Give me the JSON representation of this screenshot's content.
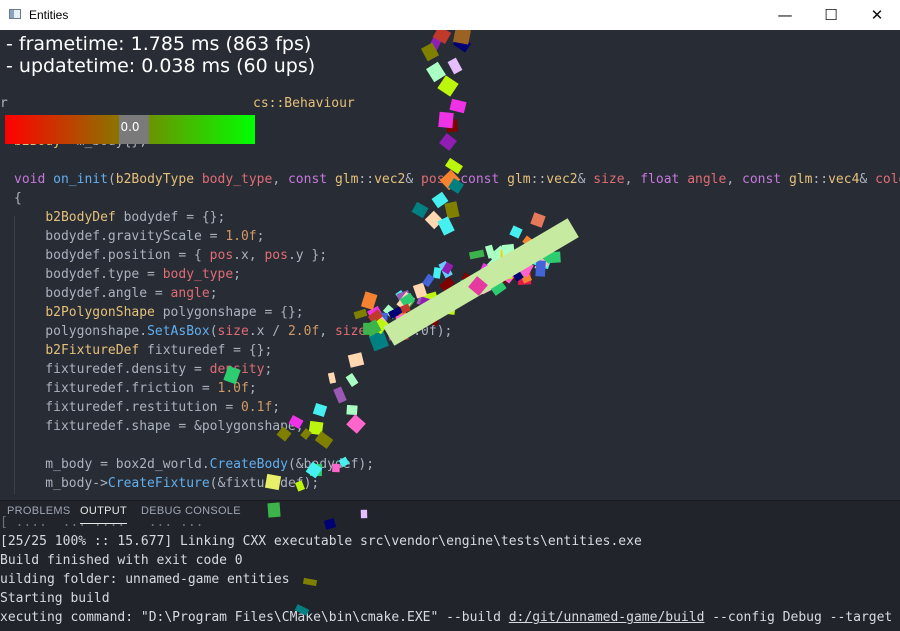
{
  "window": {
    "title": "Entities",
    "minimize_glyph": "—",
    "maximize_glyph": "☐",
    "close_glyph": "✕"
  },
  "overlay": {
    "frametime": "- frametime: 1.785 ms (863 fps)",
    "updatetime": "- updatetime: 0.038 ms (60 ups)",
    "slider_value": "0.0",
    "slider_level": 0.5
  },
  "code": [
    [
      "",
      "",
      "",
      "",
      "",
      "",
      "",
      "",
      "",
      "",
      "",
      "",
      "",
      "",
      "",
      "",
      "",
      "",
      "",
      "",
      "",
      "",
      ""
    ],
    [
      "tx",
      "r"
    ],
    [],
    [
      "ty",
      "b2Body",
      "tx",
      "* m_body{};"
    ],
    [],
    [
      "kw",
      "void ",
      "fn",
      "on_init",
      "tx",
      "(",
      "ty",
      "b2BodyType ",
      "pm",
      "body_type",
      "tx",
      ", ",
      "kw",
      "const ",
      "ty",
      "glm",
      "tx",
      "::",
      "ty",
      "vec2",
      "tx",
      "& ",
      "pm",
      "pos",
      "tx",
      ", ",
      "kw",
      "const ",
      "ty",
      "glm",
      "tx",
      "::",
      "ty",
      "vec2",
      "tx",
      "& ",
      "pm",
      "size",
      "tx",
      ", ",
      "kw",
      "float ",
      "pm",
      "angle",
      "tx",
      ", ",
      "kw",
      "const ",
      "ty",
      "glm",
      "tx",
      "::",
      "ty",
      "vec4",
      "tx",
      "& ",
      "pm",
      "color"
    ],
    [
      "tx",
      "{"
    ],
    [
      "tx",
      "    ",
      "ty",
      "b2BodyDef",
      "tx",
      " bodydef = {};"
    ],
    [
      "tx",
      "    bodydef.gravityScale = ",
      "nm",
      "1.0f",
      "tx",
      ";"
    ],
    [
      "tx",
      "    bodydef.position = { ",
      "pm",
      "pos",
      "tx",
      ".x, ",
      "pm",
      "pos",
      "tx",
      ".y };"
    ],
    [
      "tx",
      "    bodydef.type = ",
      "pm",
      "body_type",
      "tx",
      ";"
    ],
    [
      "tx",
      "    bodydef.angle = ",
      "pm",
      "angle",
      "tx",
      ";"
    ],
    [
      "tx",
      "    ",
      "ty",
      "b2PolygonShape",
      "tx",
      " polygonshape = {};"
    ],
    [
      "tx",
      "    polygonshape.",
      "fn",
      "SetAsBox",
      "tx",
      "(",
      "pm",
      "size",
      "tx",
      ".x / ",
      "nm",
      "2.0f",
      "tx",
      ", ",
      "pm",
      "size",
      "tx",
      ".y / 2.0f);"
    ],
    [
      "tx",
      "    ",
      "ty",
      "b2FixtureDef",
      "tx",
      " fixturedef = {};"
    ],
    [
      "tx",
      "    fixturedef.density = ",
      "pm",
      "density",
      "tx",
      ";"
    ],
    [
      "tx",
      "    fixturedef.friction = ",
      "nm",
      "1.0f",
      "tx",
      ";"
    ],
    [
      "tx",
      "    fixturedef.restitution = ",
      "nm",
      "0.1f",
      "tx",
      ";"
    ],
    [
      "tx",
      "    fixturedef.shape = &polygonshape;"
    ],
    [],
    [
      "tx",
      "    m_body = box2d_world.",
      "fn",
      "CreateBody",
      "tx",
      "(&bodydef);"
    ],
    [
      "tx",
      "    m_body->",
      "fn",
      "CreateFixture",
      "tx",
      "(&fixturedef);"
    ]
  ],
  "code_header_tail": {
    "text": "cs::Behaviour",
    "color": "#e5c07b"
  },
  "panel": {
    "tabs": [
      {
        "label": "PROBLEMS",
        "active": false
      },
      {
        "label": "OUTPUT",
        "active": true
      },
      {
        "label": "DEBUG CONSOLE",
        "active": false
      }
    ],
    "output": [
      "[25/25 100% :: 15.677] Linking CXX executable src\\vendor\\engine\\tests\\entities.exe",
      "Build finished with exit code 0",
      "uilding folder: unnamed-game entities",
      "Starting build",
      "xecuting command: \"D:\\Program Files\\CMake\\bin\\cmake.EXE\" --build "
    ],
    "output_link": "d:/git/unnamed-game/build",
    "output_tail": " --config Debug --target ent"
  },
  "colors": {
    "editor_bg": "#282c34",
    "panel_bg": "#21252b",
    "platform": "#c5eaa0",
    "slider_left": "#ff0000",
    "slider_right": "#00ff00"
  }
}
